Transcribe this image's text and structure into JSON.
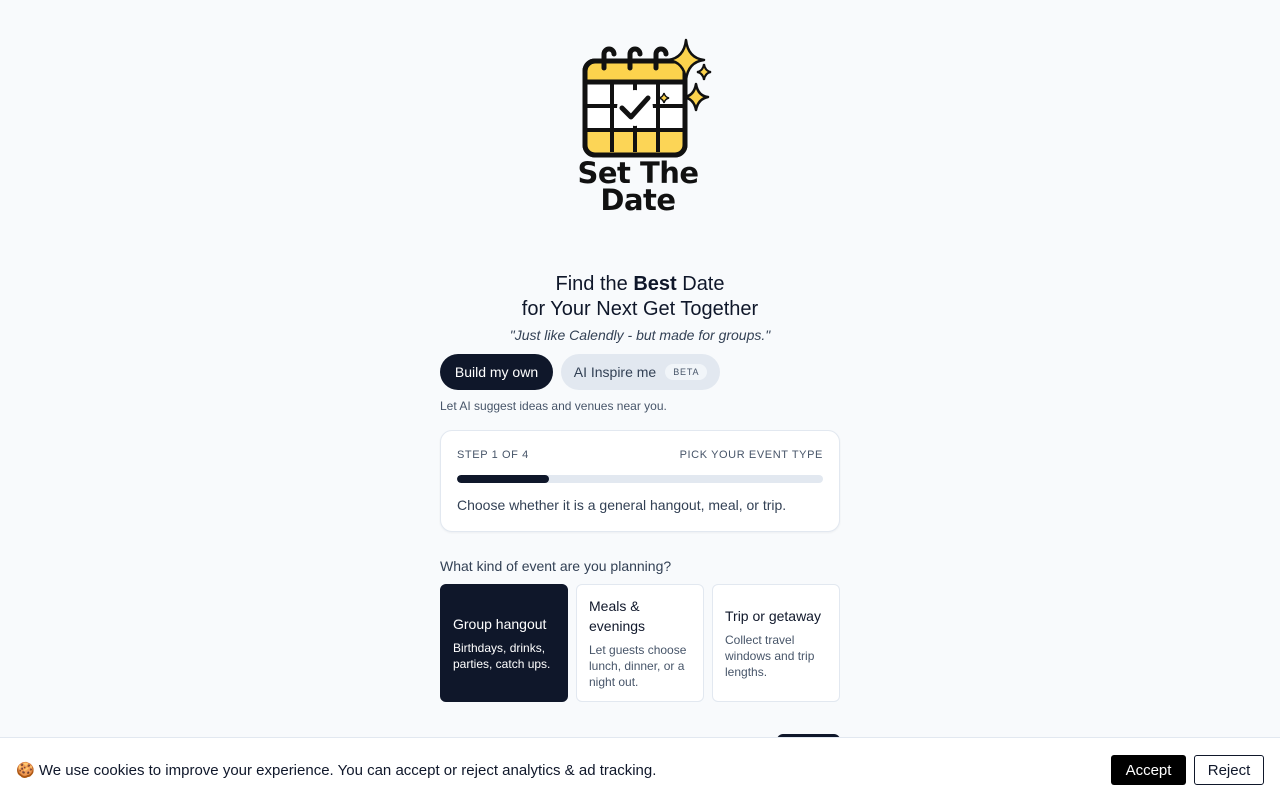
{
  "brand": {
    "logo_line1": "Set The",
    "logo_line2": "Date",
    "accent_color": "#fcd34d"
  },
  "hero": {
    "headline_prefix": "Find the ",
    "headline_bold": "Best",
    "headline_suffix": " Date",
    "headline_line2": "for Your Next Get Together",
    "tagline": "\"Just like Calendly - but made for groups.\""
  },
  "mode_toggle": {
    "build_label": "Build my own",
    "ai_label": "AI Inspire me",
    "ai_badge": "BETA",
    "selected": "Build my own",
    "hint": "Let AI suggest ideas and venues near you."
  },
  "step": {
    "counter": "STEP 1 OF 4",
    "title": "PICK YOUR EVENT TYPE",
    "progress_fraction": 0.25,
    "description": "Choose whether it is a general hangout, meal, or trip."
  },
  "event_type": {
    "question": "What kind of event are you planning?",
    "options": [
      {
        "title": "Group hangout",
        "subtitle": "Birthdays, drinks, parties, catch ups.",
        "selected": true
      },
      {
        "title": "Meals & evenings",
        "subtitle": "Let guests choose lunch, dinner, or a night out.",
        "selected": false
      },
      {
        "title": "Trip or getaway",
        "subtitle": "Collect travel windows and trip lengths.",
        "selected": false
      }
    ]
  },
  "cookie_banner": {
    "icon": "cookie-icon",
    "text": "🍪 We use cookies to improve your experience. You can accept or reject analytics & ad tracking.",
    "accept_label": "Accept",
    "reject_label": "Reject"
  }
}
